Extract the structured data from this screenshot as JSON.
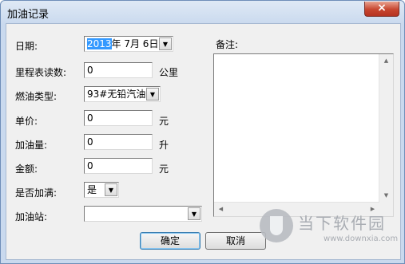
{
  "window": {
    "title": "加油记录",
    "close_glyph": "×"
  },
  "form": {
    "date": {
      "label": "日期:",
      "year_highlight": "2013",
      "rest": "年 7月 6日",
      "arrow": "▼"
    },
    "odometer": {
      "label": "里程表读数:",
      "value": "0",
      "unit": "公里"
    },
    "fuel_type": {
      "label": "燃油类型:",
      "value": "93#无铅汽油",
      "arrow": "▼"
    },
    "unit_price": {
      "label": "单价:",
      "value": "0",
      "unit": "元"
    },
    "fuel_amount": {
      "label": "加油量:",
      "value": "0",
      "unit": "升"
    },
    "total": {
      "label": "金额:",
      "value": "0",
      "unit": "元"
    },
    "full_tank": {
      "label": "是否加满:",
      "value": "是",
      "arrow": "▼"
    },
    "station": {
      "label": "加油站:",
      "value": "",
      "arrow": "▼"
    }
  },
  "memo": {
    "label": "备注:",
    "value": ""
  },
  "buttons": {
    "ok": "确定",
    "cancel": "取消"
  },
  "watermark": {
    "brand": "当下软件园",
    "url": "www.downxia.com"
  },
  "icons": [
    "close-icon",
    "dropdown-arrow-icon",
    "scroll-arrow-icon",
    "watermark-logo-icon"
  ]
}
